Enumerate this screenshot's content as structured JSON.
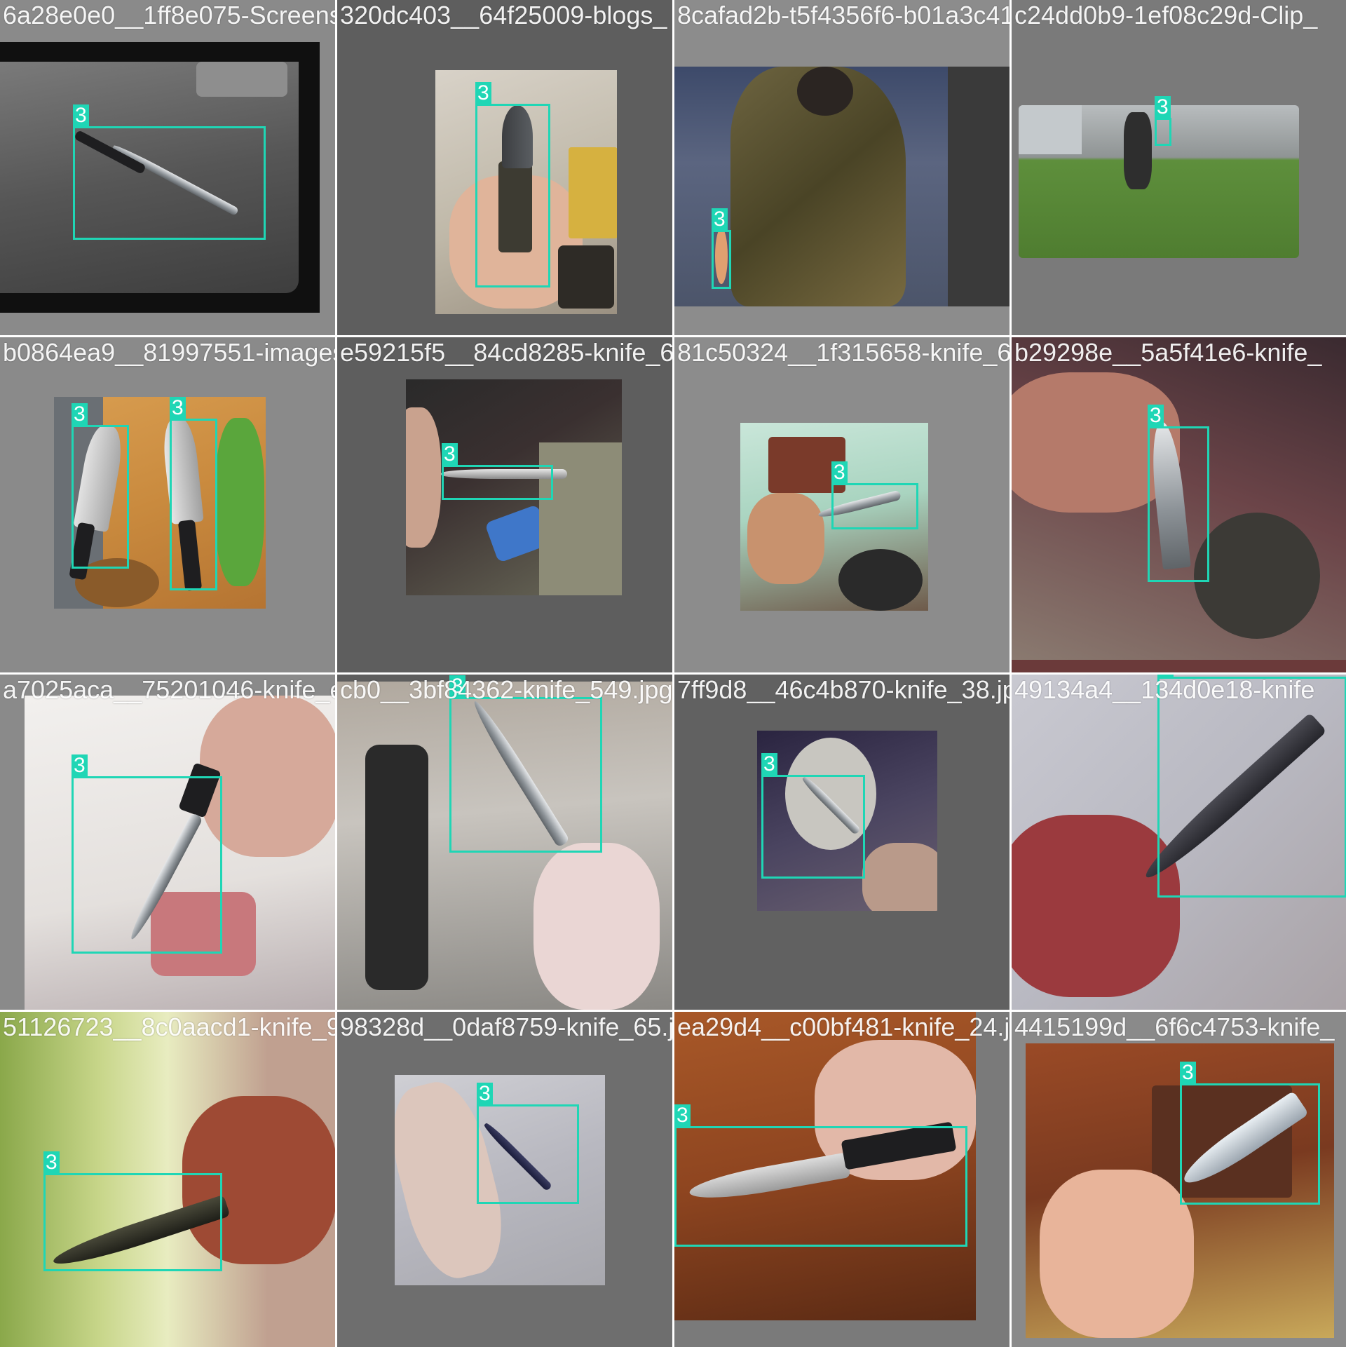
{
  "box_color": "#1fd6b5",
  "tiles": [
    {
      "filename": "6a28e0e0__1ff8e075-Screenshot-2025-04-25",
      "class_id": "3"
    },
    {
      "filename": "320dc403__64f25009-blogs_",
      "class_id": "3"
    },
    {
      "filename": "8cafad2b-t5f4356f6-b01a3c410e-1b79-1f07",
      "class_id": "3"
    },
    {
      "filename": "c24dd0b9-1ef08c29d-Clip_",
      "class_id": "3"
    },
    {
      "filename": "b0864ea9__81997551-images.jpg",
      "class_id": "3"
    },
    {
      "filename": "e59215f5__84cd8285-knife_64.jpg",
      "class_id": "3"
    },
    {
      "filename": "81c50324__1f315658-knife_628.jpg",
      "class_id": "3"
    },
    {
      "filename": "b29298e__5a5f41e6-knife_",
      "class_id": "3"
    },
    {
      "filename": "a7025aca__75201046-knife_e21.jpg",
      "class_id": "3"
    },
    {
      "filename": "cb0__3bf84362-knife_549.jpg",
      "class_id": "3"
    },
    {
      "filename": "7ff9d8__46c4b870-knife_38.jpg",
      "class_id": "3"
    },
    {
      "filename": "49134a4__134d0e18-knife",
      "class_id": "3"
    },
    {
      "filename": "51126723__8c0aacd1-knife_94.jpg",
      "class_id": "3"
    },
    {
      "filename": "98328d__0daf8759-knife_65.jpg",
      "class_id": "3"
    },
    {
      "filename": "ea29d4__c00bf481-knife_24.jpg",
      "class_id": "3"
    },
    {
      "filename": "4415199d__6f6c4753-knife_",
      "class_id": "3"
    }
  ]
}
